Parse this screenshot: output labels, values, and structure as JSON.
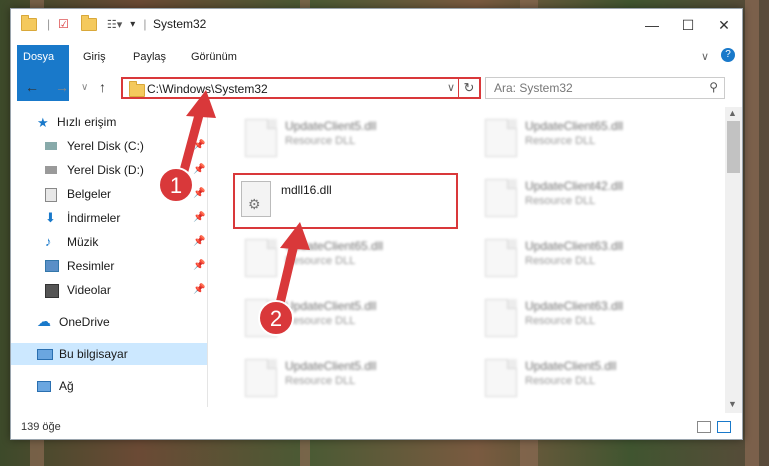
{
  "window": {
    "title": "System32",
    "min_label": "—",
    "max_label": "☐",
    "close_label": "✕",
    "help_label": "?",
    "expand_label": "∨"
  },
  "ribbon": {
    "tabs": [
      {
        "label": "Dosya"
      },
      {
        "label": "Giriş"
      },
      {
        "label": "Paylaş"
      },
      {
        "label": "Görünüm"
      }
    ]
  },
  "nav": {
    "back": "←",
    "forward": "→",
    "recent": "∨",
    "up": "↑",
    "address": "C:\\Windows\\System32",
    "search_placeholder": "Ara: System32"
  },
  "sidebar": {
    "items": [
      {
        "label": "Hızlı erişim",
        "pinned": false
      },
      {
        "label": "Yerel Disk (C:)",
        "pinned": true
      },
      {
        "label": "Yerel Disk (D:)",
        "pinned": true
      },
      {
        "label": "Belgeler",
        "pinned": true
      },
      {
        "label": "İndirmeler",
        "pinned": true
      },
      {
        "label": "Müzik",
        "pinned": true
      },
      {
        "label": "Resimler",
        "pinned": true
      },
      {
        "label": "Videolar",
        "pinned": true
      },
      {
        "label": "OneDrive",
        "pinned": false
      },
      {
        "label": "Bu bilgisayar",
        "pinned": false,
        "selected": true
      },
      {
        "label": "Ağ",
        "pinned": false
      }
    ]
  },
  "files": {
    "left": [
      {
        "name": "UpdateClient5.dll",
        "type": "Resource DLL"
      },
      {
        "name": "mdll16.dll",
        "type": ""
      },
      {
        "name": "UpdateClient65.dll",
        "type": "Resource DLL"
      },
      {
        "name": "UpdateClient5.dll",
        "type": "Resource DLL"
      },
      {
        "name": "UpdateClient5.dll",
        "type": "Resource DLL"
      }
    ],
    "right": [
      {
        "name": "UpdateClient65.dll",
        "type": "Resource DLL"
      },
      {
        "name": "UpdateClient42.dll",
        "type": "Resource DLL"
      },
      {
        "name": "UpdateClient63.dll",
        "type": "Resource DLL"
      },
      {
        "name": "UpdateClient63.dll",
        "type": "Resource DLL"
      },
      {
        "name": "UpdateClient5.dll",
        "type": "Resource DLL"
      }
    ]
  },
  "status": {
    "count": "139 öğe"
  },
  "annotations": {
    "step1": "1",
    "step2": "2",
    "color": "#d9383a"
  }
}
